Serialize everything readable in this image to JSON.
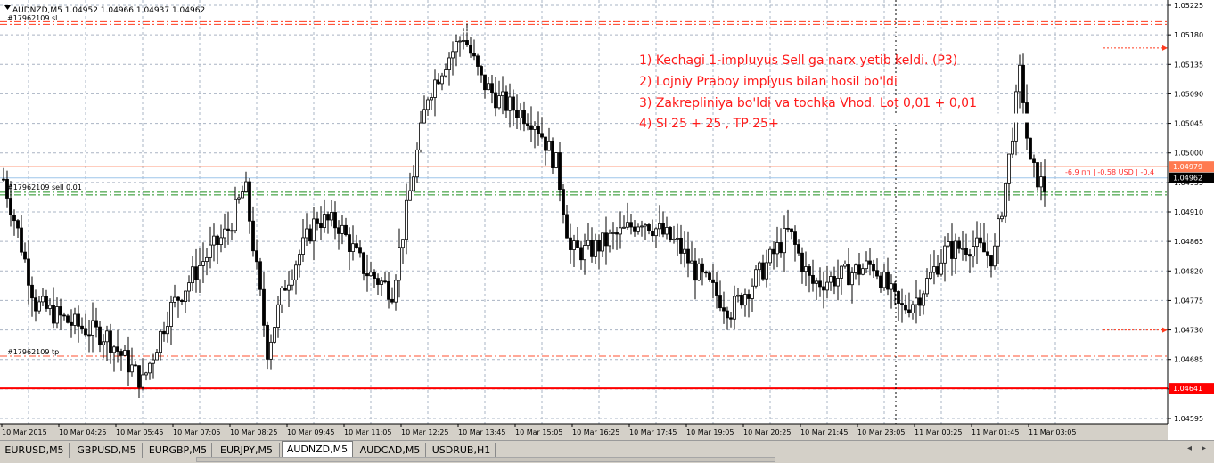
{
  "header": {
    "symbol_info": "AUDNZD,M5  1.04952 1.04966 1.04937 1.04962",
    "sl_label": "#17962109 sl"
  },
  "order_labels": {
    "sell": "#17962109 sell 0.01",
    "tp": "#17962109 tp",
    "profit": "-6.9 пп | -0.58 USD | -0.4"
  },
  "annotation": {
    "lines": [
      "1) Kechagi 1-impluyus Sell ga narx yetib keldi. (P3)",
      "2) Lojniy Praboy implyus bilan hosil bo'ldi",
      "3) Zakrepliniya bo'ldi va tochka Vhod.  Lot 0,01 + 0,01",
      "4) Sl 25 + 25  ,  TP  25+"
    ]
  },
  "colors": {
    "background": "#ffffff",
    "grid": "#aab4c4",
    "candle": "#000000",
    "sl_line": "#ff3b1f",
    "entry_line": "#ff7a50",
    "sell_line": "#1e8f1e",
    "tp_line": "#ff5030",
    "support_line": "#ff0000",
    "annotation_text": "#ff1a1a",
    "ask_line": "#9ec6ea"
  },
  "chart_data": {
    "type": "candlestick",
    "symbol": "AUDNZD",
    "timeframe": "M5",
    "ylim": [
      1.04595,
      1.05225
    ],
    "y_ticks": [
      "1.05225",
      "1.05180",
      "1.05135",
      "1.05090",
      "1.05045",
      "1.05000",
      "1.04955",
      "1.04910",
      "1.04865",
      "1.04820",
      "1.04775",
      "1.04730",
      "1.04685",
      "1.04640",
      "1.04595"
    ],
    "x_ticks": [
      "10 Mar 2015",
      "10 Mar 04:25",
      "10 Mar 05:45",
      "10 Mar 07:05",
      "10 Mar 08:25",
      "10 Mar 09:45",
      "10 Mar 11:05",
      "10 Mar 12:25",
      "10 Mar 13:45",
      "10 Mar 15:05",
      "10 Mar 16:25",
      "10 Mar 17:45",
      "10 Mar 19:05",
      "10 Mar 20:25",
      "10 Mar 21:45",
      "10 Mar 23:05",
      "11 Mar 00:25",
      "11 Mar 01:45",
      "11 Mar 03:05"
    ],
    "price_levels": [
      {
        "name": "sl",
        "price": 1.052,
        "style": "dashdot",
        "color": "#ff3b1f"
      },
      {
        "name": "entry",
        "price": 1.04979,
        "style": "solid",
        "color": "#ff7a50",
        "label": "1.04979"
      },
      {
        "name": "bid",
        "price": 1.04962,
        "style": "solid",
        "color": "#9ec6ea",
        "label": "1.04962"
      },
      {
        "name": "sell",
        "price": 1.0494,
        "style": "dashdot",
        "color": "#1e8f1e"
      },
      {
        "name": "tp",
        "price": 1.0469,
        "style": "dashdot",
        "color": "#ff5030"
      },
      {
        "name": "support",
        "price": 1.04641,
        "style": "solid",
        "color": "#ff0000",
        "label": "1.04641"
      }
    ],
    "price_labels_dotted": [
      {
        "price": 1.0516,
        "label": "1.05160"
      },
      {
        "price": 1.0473,
        "label": "1.04730"
      }
    ],
    "current_price": 1.04962
  },
  "tabs": [
    {
      "label": "EURUSD,M5"
    },
    {
      "label": "GBPUSD,M5"
    },
    {
      "label": "EURGBP,M5"
    },
    {
      "label": "EURJPY,M5"
    },
    {
      "label": "AUDNZD,M5",
      "active": true
    },
    {
      "label": "AUDCAD,M5"
    },
    {
      "label": "USDRUB,H1"
    }
  ],
  "tab_scroll": {
    "left": "◂",
    "right": "▸"
  }
}
